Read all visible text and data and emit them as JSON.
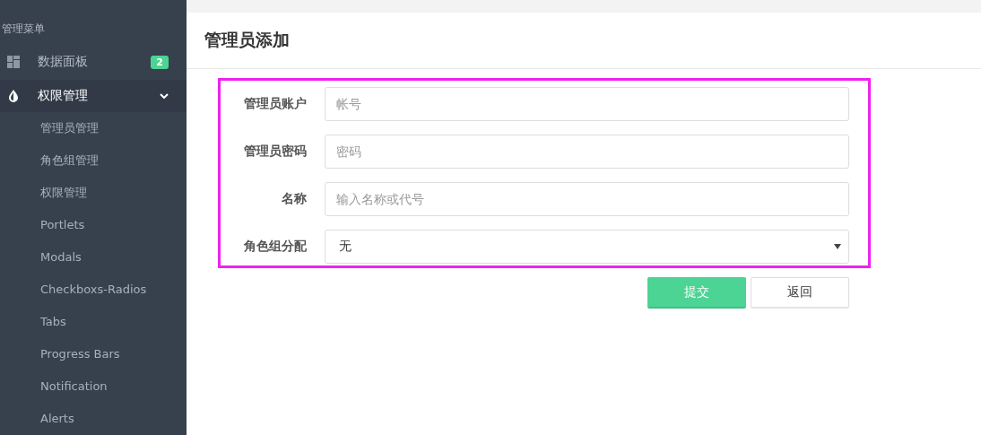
{
  "sidebar": {
    "heading": "管理菜单",
    "items": [
      {
        "label": "数据面板",
        "kind": "dashboard",
        "badge": "2",
        "selected": false
      },
      {
        "label": "权限管理",
        "kind": "permissions",
        "selected": true,
        "expanded": true,
        "children": [
          {
            "label": "管理员管理"
          },
          {
            "label": "角色组管理"
          },
          {
            "label": "权限管理"
          },
          {
            "label": "Portlets"
          },
          {
            "label": "Modals"
          },
          {
            "label": "Checkboxs-Radios"
          },
          {
            "label": "Tabs"
          },
          {
            "label": "Progress Bars"
          },
          {
            "label": "Notification"
          },
          {
            "label": "Alerts"
          }
        ]
      }
    ]
  },
  "page": {
    "title": "管理员添加"
  },
  "form": {
    "highlighted": true,
    "fields": [
      {
        "kind": "text",
        "label": "管理员账户",
        "placeholder": "帐号"
      },
      {
        "kind": "text",
        "label": "管理员密码",
        "placeholder": "密码"
      },
      {
        "kind": "text",
        "label": "名称",
        "placeholder": "输入名称或代号"
      },
      {
        "kind": "select",
        "label": "角色组分配",
        "value": "无"
      }
    ]
  },
  "buttons": [
    {
      "kind": "primary",
      "label": "提交"
    },
    {
      "kind": "default",
      "label": "返回"
    }
  ]
}
